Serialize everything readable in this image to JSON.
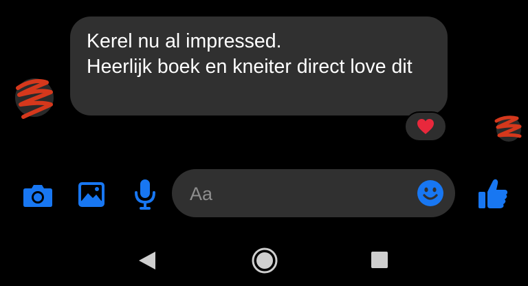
{
  "conversation": {
    "message": {
      "lines": [
        "Kerel nu al impressed.",
        "Heerlijk boek en kneiter direct love dit"
      ]
    },
    "reaction": {
      "icon": "heart-icon",
      "color": "#e8283c"
    }
  },
  "composer": {
    "placeholder": "Aa",
    "icons": [
      "camera-icon",
      "image-icon",
      "microphone-icon",
      "smiley-icon",
      "thumbs-up-icon"
    ]
  },
  "navigation_bar": {
    "icons": [
      "back-triangle-icon",
      "home-circle-icon",
      "recents-square-icon"
    ]
  },
  "colors": {
    "background": "#000000",
    "bubble": "#303030",
    "accent_blue": "#1877f2",
    "text": "#ffffff",
    "placeholder": "#8e8e8e",
    "scribble": "#d5381c",
    "nav_icons": "#cfcfcf"
  }
}
